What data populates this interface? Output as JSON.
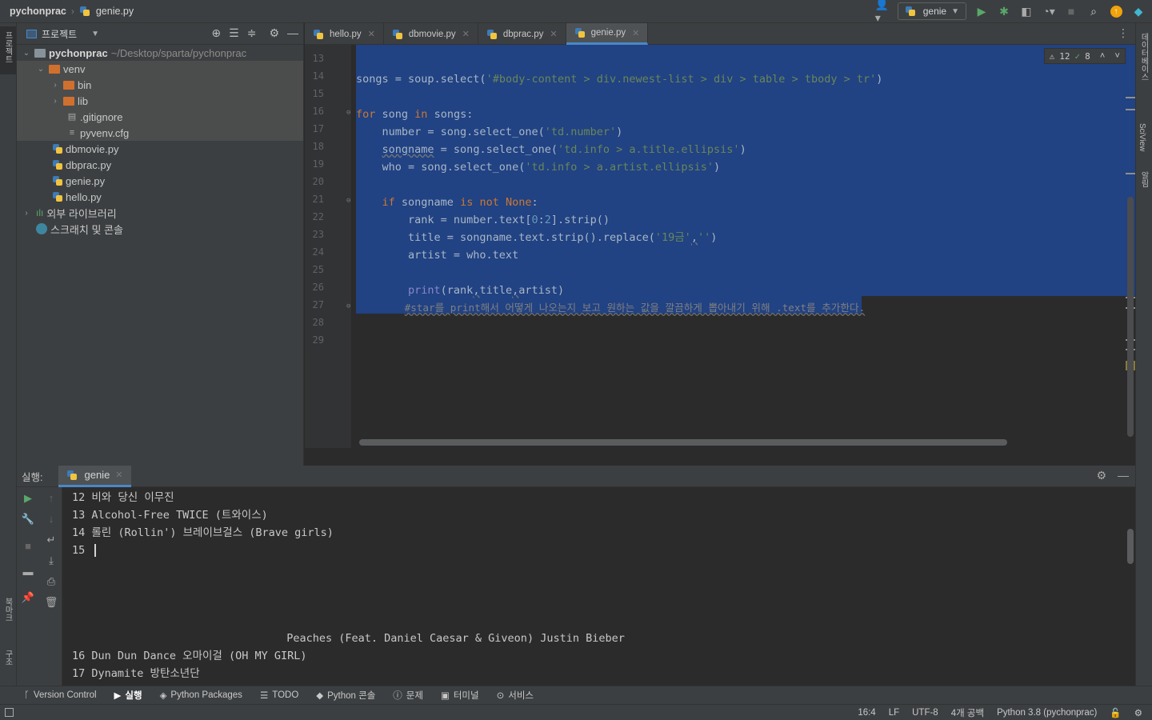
{
  "titlebar": {
    "project": "pychonprac",
    "file": "genie.py",
    "run_config": "genie"
  },
  "left_stripe": {
    "project_tab": "프로젝트",
    "bookmarks_tab": "북마크",
    "structure_tab": "구조"
  },
  "right_stripe": {
    "database_tab": "데이터베이스",
    "sciview_tab": "SciView",
    "notifications_tab": "알림"
  },
  "project": {
    "title": "프로젝트",
    "tree": [
      {
        "label": "pychonprac",
        "hint": "~/Desktop/sparta/pychonprac"
      },
      {
        "label": "venv"
      },
      {
        "label": "bin"
      },
      {
        "label": "lib"
      },
      {
        "label": ".gitignore"
      },
      {
        "label": "pyvenv.cfg"
      },
      {
        "label": "dbmovie.py"
      },
      {
        "label": "dbprac.py"
      },
      {
        "label": "genie.py"
      },
      {
        "label": "hello.py"
      },
      {
        "label": "외부 라이브러리"
      },
      {
        "label": "스크래치 및 콘솔"
      }
    ]
  },
  "tabs": [
    {
      "label": "hello.py"
    },
    {
      "label": "dbmovie.py"
    },
    {
      "label": "dbprac.py"
    },
    {
      "label": "genie.py"
    }
  ],
  "editor": {
    "inspection": {
      "warnings": "12",
      "ok": "8"
    },
    "line_numbers": [
      "13",
      "14",
      "15",
      "16",
      "17",
      "18",
      "19",
      "20",
      "21",
      "22",
      "23",
      "24",
      "25",
      "26",
      "27",
      "28",
      "29"
    ],
    "code": {
      "l14": {
        "a": "songs = soup.select(",
        "b": "'#body-content > div.newest-list > div > table > tbody > tr'",
        "c": ")"
      },
      "l16": {
        "kw1": "for",
        "a": " song ",
        "kw2": "in",
        "b": " songs:"
      },
      "l17": {
        "a": "    number = song.select_one(",
        "b": "'td.number'",
        "c": ")"
      },
      "l18": {
        "indent": "    ",
        "a": "songname",
        "b": " = song.select_one(",
        "c": "'td.info > a.title.ellipsis'",
        "d": ")"
      },
      "l19": {
        "a": "    who = song.select_one(",
        "b": "'td.info > a.artist.ellipsis'",
        "c": ")"
      },
      "l21": {
        "indent": "    ",
        "kw1": "if",
        "a": " songname ",
        "kw2": "is not",
        "sp": " ",
        "kw3": "None",
        "b": ":"
      },
      "l22": {
        "a": "        rank = number.text[",
        "n1": "0",
        "c": ":",
        "n2": "2",
        "d": "].strip()"
      },
      "l23": {
        "a": "        title = songname.text.strip().replace(",
        "b": "'19금'",
        "c": ",",
        "d": "''",
        "e": ")"
      },
      "l24": {
        "a": "        artist = who.text"
      },
      "l26": {
        "indent": "        ",
        "fn": "print",
        "a": "(rank",
        "c1": ",",
        "b": "title",
        "c2": ",",
        "c": "artist)"
      },
      "l27": {
        "indent": "        ",
        "cm": "#star를 print해서 어떻게 나오는지 보고 원하는 값을 깔끔하게 뽑아내기 위해 .text를 추가한다."
      }
    }
  },
  "run": {
    "label": "실행:",
    "tab": "genie",
    "console": [
      "12 비와 당신 이무진",
      "13 Alcohol-Free TWICE (트와이스)",
      "14 롤린 (Rollin') 브레이브걸스 (Brave girls)",
      "15 ",
      "",
      "",
      "",
      "                                 Peaches (Feat. Daniel Caesar & Giveon) Justin Bieber",
      "16 Dun Dun Dance 오마이걸 (OH MY GIRL)",
      "17 Dynamite 방탄소년단"
    ]
  },
  "bottom_tools": [
    {
      "label": "Version Control"
    },
    {
      "label": "실행"
    },
    {
      "label": "Python Packages"
    },
    {
      "label": "TODO"
    },
    {
      "label": "Python 콘솔"
    },
    {
      "label": "문제"
    },
    {
      "label": "터미널"
    },
    {
      "label": "서비스"
    }
  ],
  "status": {
    "position": "16:4",
    "line_sep": "LF",
    "encoding": "UTF-8",
    "indent": "4개 공백",
    "interpreter": "Python 3.8 (pychonprac)"
  },
  "colors": {
    "selection": "#214283",
    "keyword": "#cc7832",
    "string": "#6a8759",
    "accent": "#4a88c7"
  }
}
